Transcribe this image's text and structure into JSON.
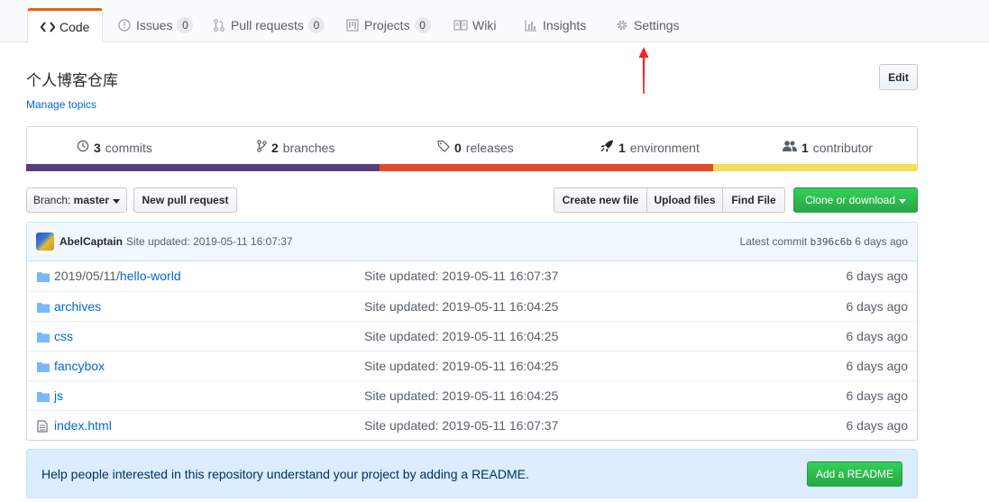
{
  "tabs": [
    {
      "label": "Code",
      "icon": "code-icon",
      "counter": null
    },
    {
      "label": "Issues",
      "icon": "issue-icon",
      "counter": "0"
    },
    {
      "label": "Pull requests",
      "icon": "pull-request-icon",
      "counter": "0"
    },
    {
      "label": "Projects",
      "icon": "project-icon",
      "counter": "0"
    },
    {
      "label": "Wiki",
      "icon": "book-icon",
      "counter": null
    },
    {
      "label": "Insights",
      "icon": "graph-icon",
      "counter": null
    },
    {
      "label": "Settings",
      "icon": "gear-icon",
      "counter": null
    }
  ],
  "repo": {
    "description": "个人博客仓库",
    "manage_topics": "Manage topics",
    "edit_label": "Edit"
  },
  "summary": {
    "commits_count": "3",
    "commits_label": "commits",
    "branches_count": "2",
    "branches_label": "branches",
    "releases_count": "0",
    "releases_label": "releases",
    "environments_count": "1",
    "environments_label": "environment",
    "contributors_count": "1",
    "contributors_label": "contributor"
  },
  "language_colors": [
    "#563d7c",
    "#e34c26",
    "#f1e05a"
  ],
  "language_fractions": [
    0.396,
    0.374,
    0.23
  ],
  "file_nav": {
    "branch_prefix": "Branch:",
    "branch_name": "master",
    "new_pull_request": "New pull request",
    "create_new_file": "Create new file",
    "upload_files": "Upload files",
    "find_file": "Find File",
    "clone_or_download": "Clone or download"
  },
  "commit": {
    "author": "AbelCaptain",
    "message": "Site updated: 2019-05-11 16:07:37",
    "latest_label": "Latest commit",
    "sha": "b396c6b",
    "age": "6 days ago"
  },
  "files": [
    {
      "type": "dir",
      "prefix": "2019/05/11/",
      "name": "hello-world",
      "message": "Site updated: 2019-05-11 16:07:37",
      "age": "6 days ago"
    },
    {
      "type": "dir",
      "prefix": "",
      "name": "archives",
      "message": "Site updated: 2019-05-11 16:04:25",
      "age": "6 days ago"
    },
    {
      "type": "dir",
      "prefix": "",
      "name": "css",
      "message": "Site updated: 2019-05-11 16:04:25",
      "age": "6 days ago"
    },
    {
      "type": "dir",
      "prefix": "",
      "name": "fancybox",
      "message": "Site updated: 2019-05-11 16:04:25",
      "age": "6 days ago"
    },
    {
      "type": "dir",
      "prefix": "",
      "name": "js",
      "message": "Site updated: 2019-05-11 16:04:25",
      "age": "6 days ago"
    },
    {
      "type": "file",
      "prefix": "",
      "name": "index.html",
      "message": "Site updated: 2019-05-11 16:07:37",
      "age": "6 days ago"
    }
  ],
  "readme_banner": {
    "text": "Help people interested in this repository understand your project by adding a README.",
    "button": "Add a README"
  },
  "colors": {
    "accent_orange": "#e36209",
    "link_blue": "#0366d6",
    "green_button": "#28a745",
    "annotation_arrow": "#f5222d"
  }
}
